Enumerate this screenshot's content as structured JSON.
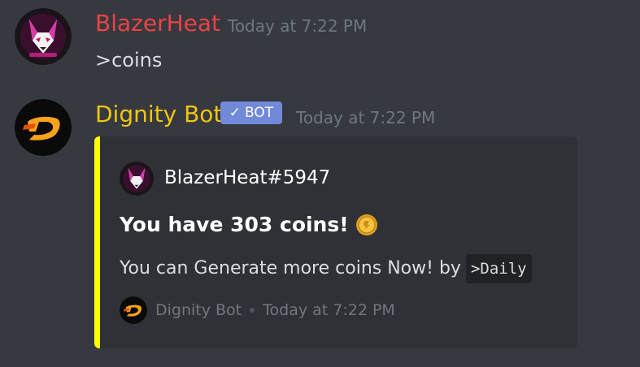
{
  "messages": [
    {
      "author": "BlazerHeat",
      "author_color": "#ed4245",
      "timestamp": "Today at 7:22 PM",
      "content": ">coins",
      "avatar_icon": "fox-mask-avatar"
    },
    {
      "author": "Dignity Bot",
      "author_color": "#f1c40f",
      "bot_tag": "BOT",
      "bot_tag_check": "✓",
      "timestamp": "Today at 7:22 PM",
      "avatar_icon": "dignity-d-logo",
      "embed": {
        "color": "#ffff00",
        "author_name": "BlazerHeat#5947",
        "title": "You have 303 coins!",
        "title_icon": "coin-icon",
        "description": "You can Generate more coins Now! by",
        "code": ">Daily",
        "footer_text": "Dignity Bot",
        "footer_timestamp": "Today at 7:22 PM"
      }
    }
  ]
}
